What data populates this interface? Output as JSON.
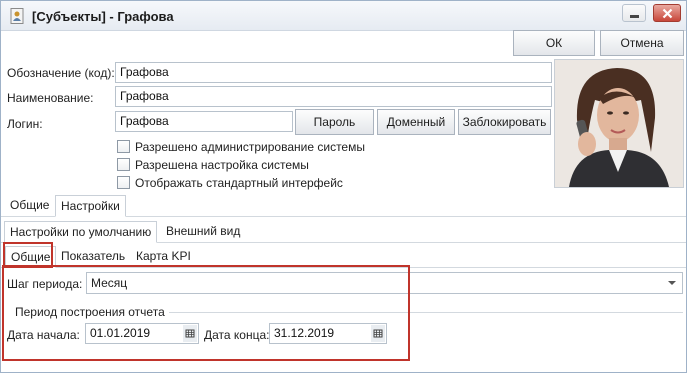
{
  "window": {
    "title": "[Субъекты] - Графова"
  },
  "toolbar": {
    "ok_label": "ОК",
    "cancel_label": "Отмена"
  },
  "form": {
    "code_label": "Обозначение (код):",
    "code_value": "Графова",
    "name_label": "Наименование:",
    "name_value": "Графова",
    "login_label": "Логин:",
    "login_value": "Графова",
    "password_button": "Пароль",
    "domain_button": "Доменный",
    "block_button": "Заблокировать"
  },
  "checkboxes": [
    {
      "label": "Разрешено администрирование системы",
      "checked": false
    },
    {
      "label": "Разрешена настройка системы",
      "checked": false
    },
    {
      "label": "Отображать стандартный интерфейс",
      "checked": false
    }
  ],
  "tabs_main": [
    {
      "label": "Общие"
    },
    {
      "label": "Настройки"
    }
  ],
  "tabs_settings": [
    {
      "label": "Настройки по умолчанию"
    },
    {
      "label": "Внешний вид"
    }
  ],
  "tabs_sub": [
    {
      "label": "Общие"
    },
    {
      "label": "Показатель"
    },
    {
      "label": "Карта KPI"
    }
  ],
  "period": {
    "step_label": "Шаг периода:",
    "step_value": "Месяц",
    "group_title": "Период построения отчета",
    "start_label": "Дата начала:",
    "start_value": "01.01.2019",
    "end_label": "Дата конца:",
    "end_value": "31.12.2019"
  },
  "colors": {
    "highlight": "#c0342b",
    "title_bar": "#e6ebf2"
  }
}
